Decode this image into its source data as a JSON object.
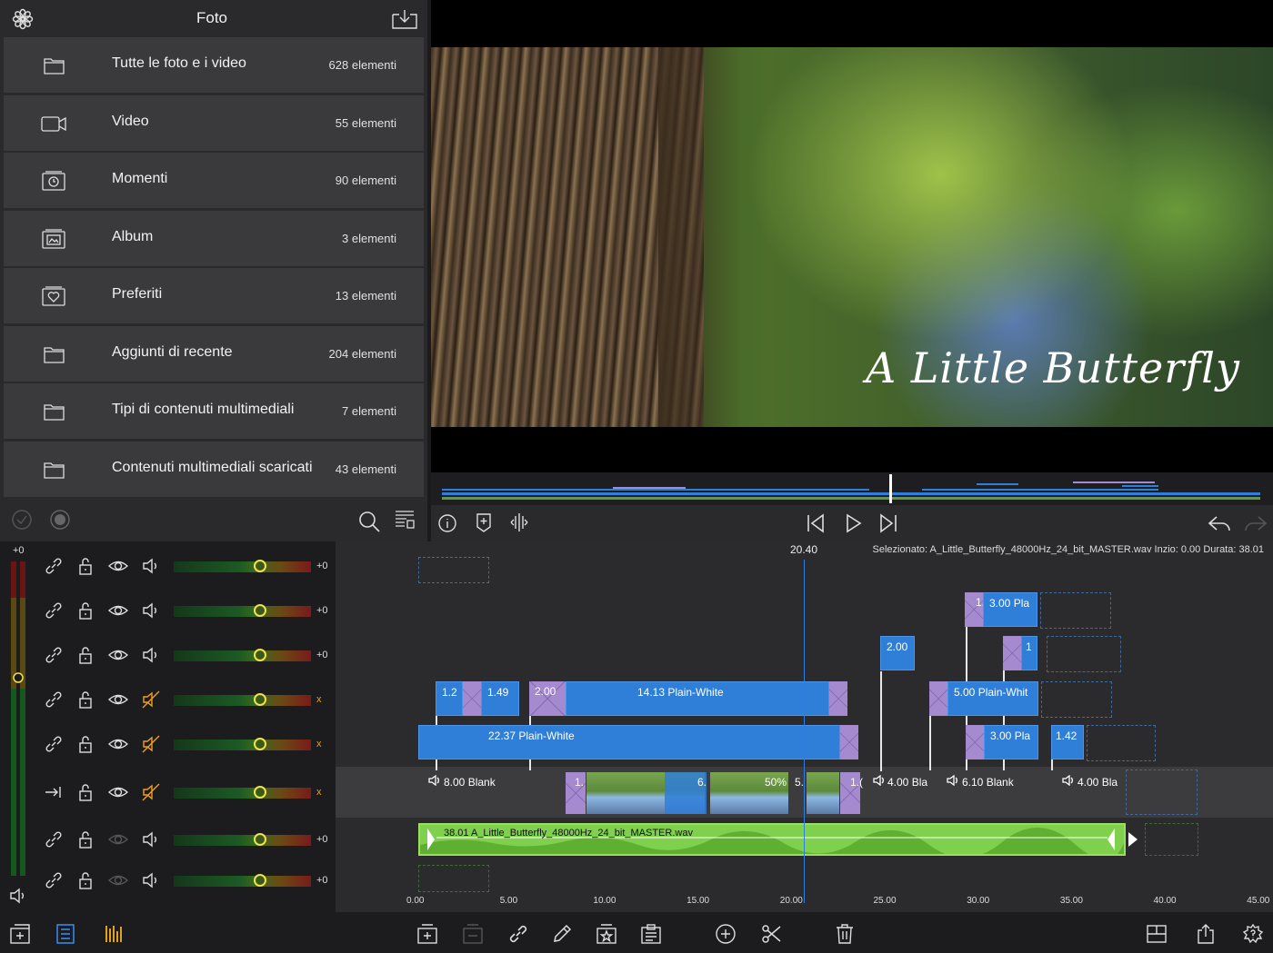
{
  "browser": {
    "title": "Foto",
    "rows": [
      {
        "label": "Tutte le foto e i video",
        "count": "628 elementi",
        "icon": "folder-icon"
      },
      {
        "label": "Video",
        "count": "55 elementi",
        "icon": "video-camera-icon"
      },
      {
        "label": "Momenti",
        "count": "90 elementi",
        "icon": "moments-clock-icon"
      },
      {
        "label": "Album",
        "count": "3 elementi",
        "icon": "album-icon"
      },
      {
        "label": "Preferiti",
        "count": "13 elementi",
        "icon": "favorites-heart-icon"
      },
      {
        "label": "Aggiunti di recente",
        "count": "204 elementi",
        "icon": "folder-icon"
      },
      {
        "label": "Tipi di contenuti multimediali",
        "count": "7 elementi",
        "icon": "folder-icon"
      },
      {
        "label": "Contenuti multimediali scaricati",
        "count": "43 elementi",
        "icon": "folder-icon"
      }
    ]
  },
  "viewer": {
    "title_overlay": "A Little Butterfly"
  },
  "mixer": {
    "master_value": "+0",
    "tracks": [
      {
        "value": "+0",
        "muted": false,
        "hidden": false,
        "level": 0.63
      },
      {
        "value": "+0",
        "muted": false,
        "hidden": false,
        "level": 0.63
      },
      {
        "value": "+0",
        "muted": false,
        "hidden": false,
        "level": 0.63
      },
      {
        "value": "x",
        "muted": true,
        "hidden": false,
        "level": 0.63
      },
      {
        "value": "x",
        "muted": true,
        "hidden": false,
        "level": 0.63
      },
      {
        "value": "x",
        "muted": true,
        "hidden": false,
        "level": 0.63
      },
      {
        "value": "+0",
        "muted": false,
        "hidden": true,
        "level": 0.63
      },
      {
        "value": "+0",
        "muted": false,
        "hidden": true,
        "level": 0.63
      }
    ]
  },
  "timeline": {
    "playhead_time": "20.40",
    "selection_info": "Selezionato: A_Little_Butterfly_48000Hz_24_bit_MASTER.wav Inzio: 0.00 Durata: 38.01",
    "clips": {
      "c1": "1.2",
      "c2": "1.",
      "c3": "1.49",
      "c4": "2.00",
      "c5": "14.13  Plain-White",
      "c6": "1.",
      "c7": "22.37  Plain-White",
      "c8": "1.",
      "c9": "2.00",
      "c10": "1.",
      "c11": "3.00  Pla",
      "c12": "1",
      "c13": "1.",
      "c14": "5.00  Plain-Whit",
      "c15": "1.",
      "c16": "3.00  Pla",
      "c17": "1.42"
    },
    "primary": {
      "p1": "8.00  Blank",
      "p2": "1.",
      "p3": "6.",
      "p4": "50%",
      "p5": "5.",
      "p6": "1.(",
      "p7": "4.00  Bla",
      "p8": "6.10  Blank",
      "p9": "4.00  Bla"
    },
    "audio_label": "38.01  A_Little_Butterfly_48000Hz_24_bit_MASTER.wav",
    "ruler": [
      "0.00",
      "5.00",
      "10.00",
      "15.00",
      "20.00",
      "25.00",
      "30.00",
      "35.00",
      "40.00",
      "45.00"
    ]
  },
  "colors": {
    "clip_blue": "#2f7ed8",
    "transition_purple": "#a58ad0",
    "audio_green": "#7fd04c",
    "playhead": "#2f7fe0",
    "mute_orange": "#f0a020"
  }
}
